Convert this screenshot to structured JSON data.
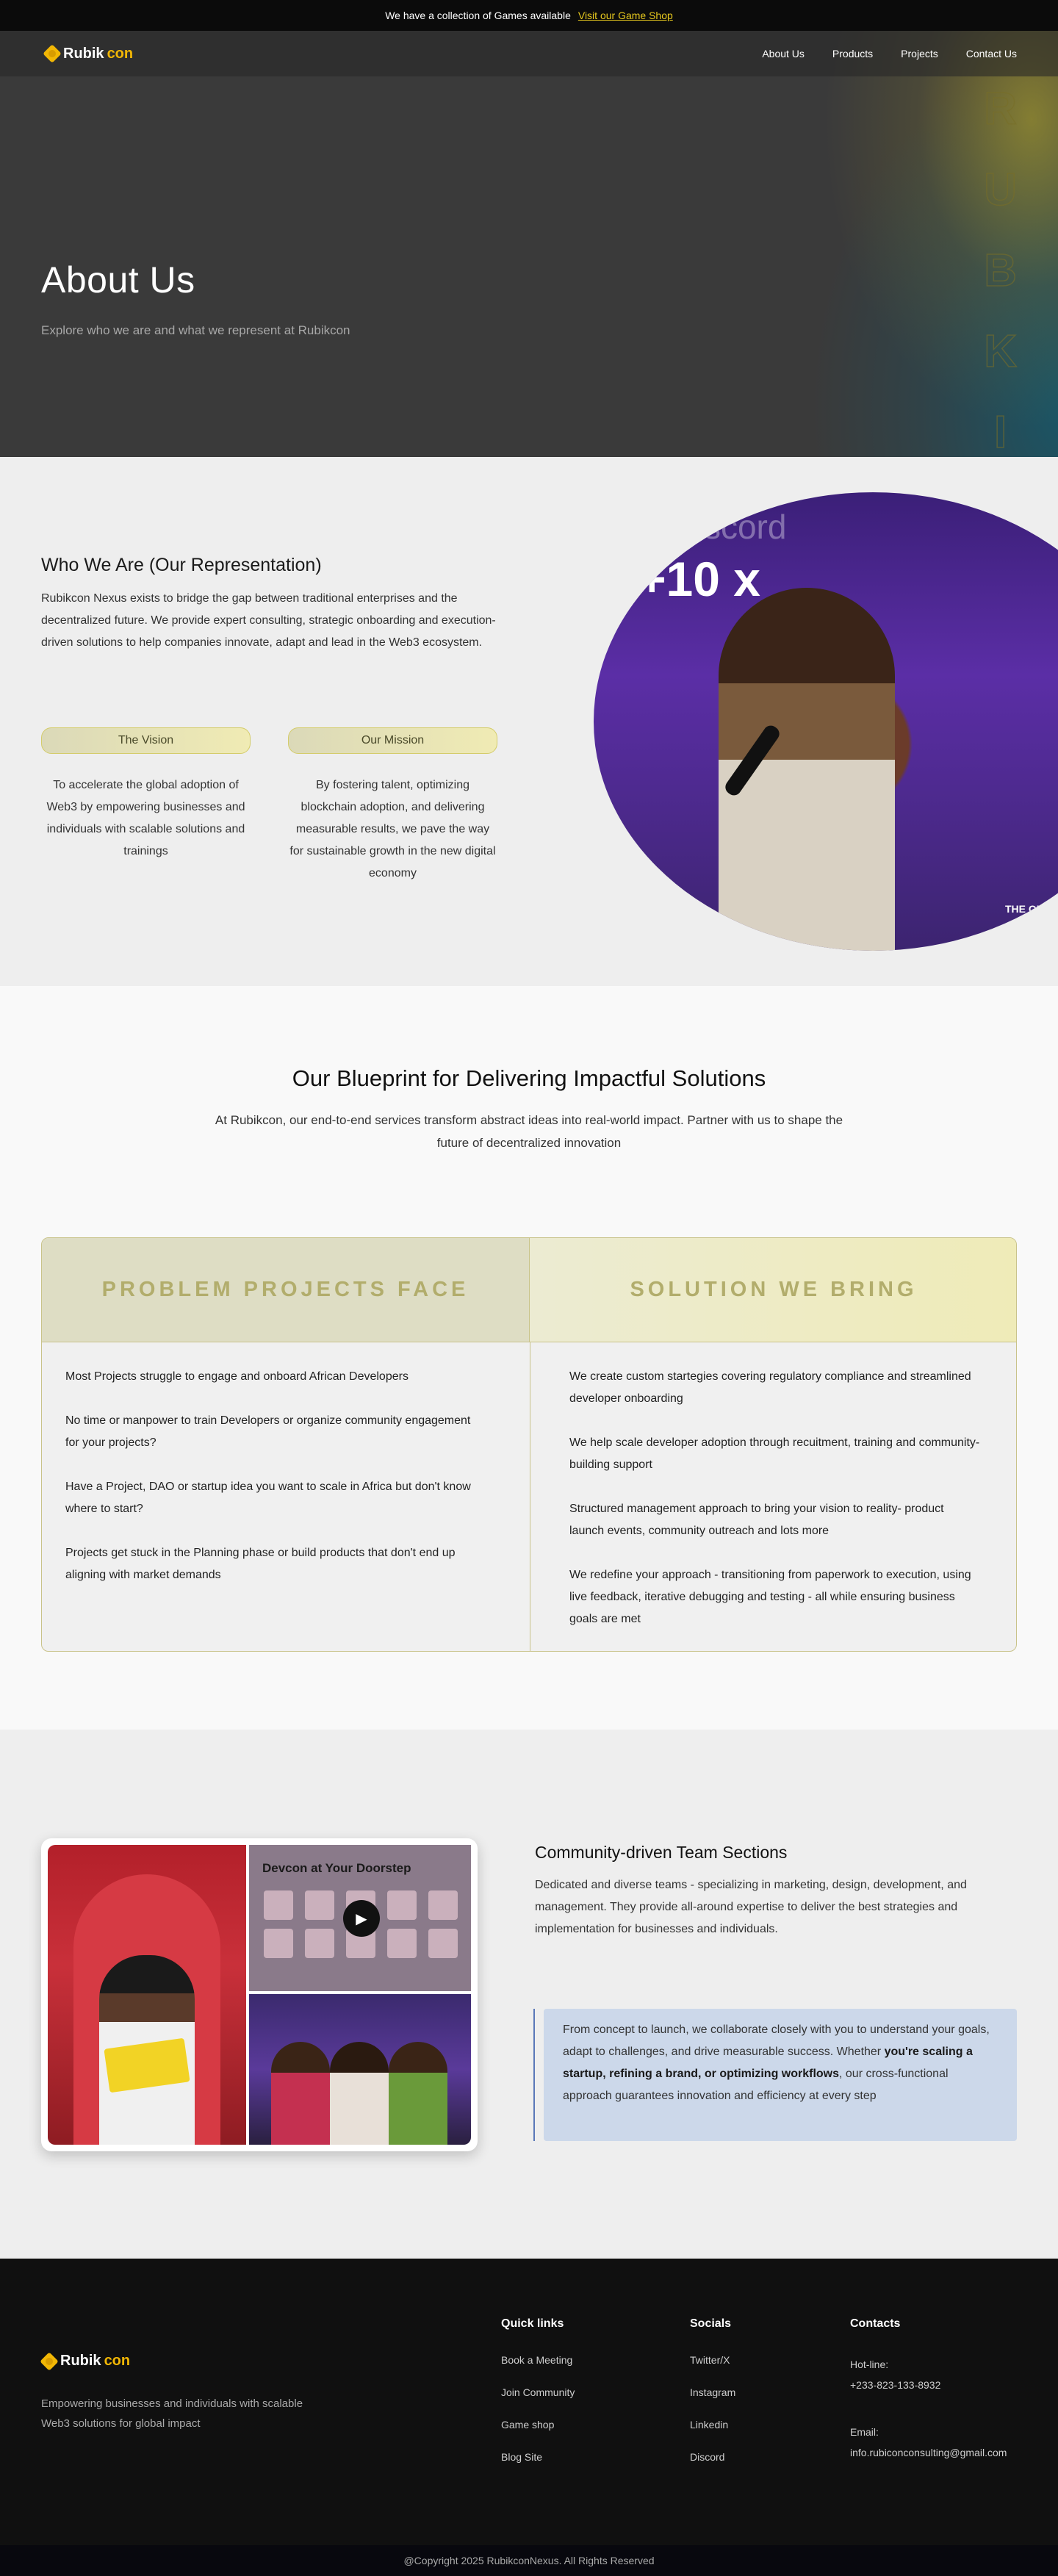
{
  "announcement": {
    "text": "We have a collection of Games available",
    "link": "Visit our Game Shop"
  },
  "brand": {
    "part1": "Rubik",
    "part2": "con",
    "accent": "#f2b705"
  },
  "nav": {
    "items": [
      "About Us",
      "Products",
      "Projects",
      "Contact Us"
    ]
  },
  "hero": {
    "title": "About Us",
    "subtitle": "Explore who we are and what we represent at Rubikcon",
    "vertical_letters": [
      "R",
      "U",
      "B",
      "K",
      "I"
    ]
  },
  "who": {
    "title": "Who We Are (Our Representation)",
    "intro": "Rubikcon Nexus exists to bridge the gap between traditional enterprises and the decentralized future. We provide expert consulting, strategic onboarding and execution-driven solutions to help companies innovate, adapt and lead in the Web3 ecosystem.",
    "vision": {
      "label": "The Vision",
      "text": "To accelerate the global adoption of Web3 by empowering businesses and individuals  with scalable solutions and trainings"
    },
    "mission": {
      "label": "Our Mission",
      "text": "By fostering talent, optimizing blockchain adoption, and delivering measurable results, we pave the way for sustainable growth in the new digital economy"
    },
    "photo": {
      "banner": "ect discord",
      "banner2": "+10 x",
      "brand": "THE OLI BRAND"
    }
  },
  "blueprint": {
    "title": "Our Blueprint for Delivering Impactful Solutions",
    "subtitle": "At Rubikcon, our end-to-end services transform abstract ideas into real-world impact. Partner with us to shape the future of decentralized innovation",
    "problem_title": "PROBLEM PROJECTS FACE",
    "solution_title": "SOLUTION WE BRING",
    "problems": [
      "Most Projects struggle to engage and onboard African Developers",
      "No time or manpower to train Developers or organize community engagement for your projects?",
      "Have a Project, DAO or startup idea you want to scale in Africa but don't know where to start?",
      "Projects get stuck in the Planning phase or build products that don't end up aligning with market demands"
    ],
    "solutions": [
      "We create custom startegies covering regulatory compliance and streamlined developer onboarding",
      "We help scale developer adoption through recuitment, training and community-building support",
      "Structured management approach to bring your vision to reality- product launch events, community outreach and lots more",
      "We redefine your approach - transitioning from paperwork to execution, using live feedback, iterative debugging and testing - all while ensuring business goals are met"
    ]
  },
  "community": {
    "title": "Community-driven Team Sections",
    "description": "Dedicated and diverse teams - specializing in marketing, design, development, and management. They provide all-around expertise to deliver the best strategies and implementation for businesses and individuals.",
    "quote_pre": "From concept to launch, we collaborate closely with you to understand your goals, adapt to challenges, and drive measurable success. Whether ",
    "quote_bold": "you're scaling a startup, refining a brand, or optimizing workflows",
    "quote_post": ", our cross-functional approach guarantees innovation and efficiency at every step",
    "video_title": "Devcon at Your Doorstep"
  },
  "footer": {
    "tagline": "Empowering businesses and individuals with scalable Web3 solutions for global impact",
    "quick_links_title": "Quick links",
    "quick_links": [
      "Book a Meeting",
      "Join Community",
      "Game shop",
      "Blog Site"
    ],
    "socials_title": "Socials",
    "socials": [
      "Twitter/X",
      "Instagram",
      "Linkedin",
      "Discord"
    ],
    "contacts_title": "Contacts",
    "hotline_label": "Hot-line:",
    "hotline": "+233-823-133-8932",
    "email_label": "Email:",
    "email": "info.rubiconconsulting@gmail.com",
    "copyright": "@Copyright 2025 RubikconNexus. All Rights Reserved"
  }
}
